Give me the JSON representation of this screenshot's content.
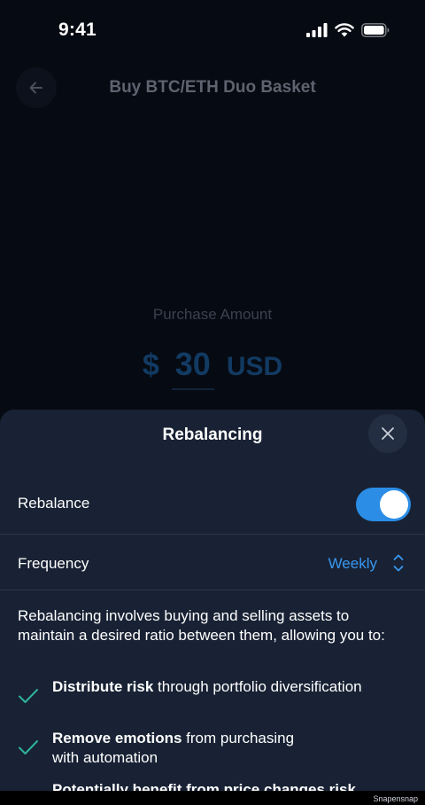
{
  "status_bar": {
    "time": "9:41"
  },
  "header": {
    "title": "Buy BTC/ETH Duo Basket"
  },
  "purchase": {
    "label": "Purchase Amount",
    "currency_symbol": "$",
    "amount": "30",
    "currency": "USD"
  },
  "sheet": {
    "title": "Rebalancing",
    "rebalance": {
      "label": "Rebalance",
      "enabled": true
    },
    "frequency": {
      "label": "Frequency",
      "value": "Weekly"
    },
    "description": "Rebalancing involves buying and selling assets to maintain a desired ratio between them, allowing you to:",
    "bullets": [
      {
        "bold": "Distribute risk",
        "rest": " through portfolio diversification"
      },
      {
        "bold": "Remove emotions",
        "rest": " from purchasing with automation"
      },
      {
        "bold": "Potentially benefit from price changes risk",
        "rest": ""
      }
    ]
  },
  "watermark": "Snapensnap",
  "colors": {
    "accent": "#2b8de6",
    "check": "#2fb39a",
    "sheet_bg": "#182234",
    "page_bg": "#060a12"
  }
}
